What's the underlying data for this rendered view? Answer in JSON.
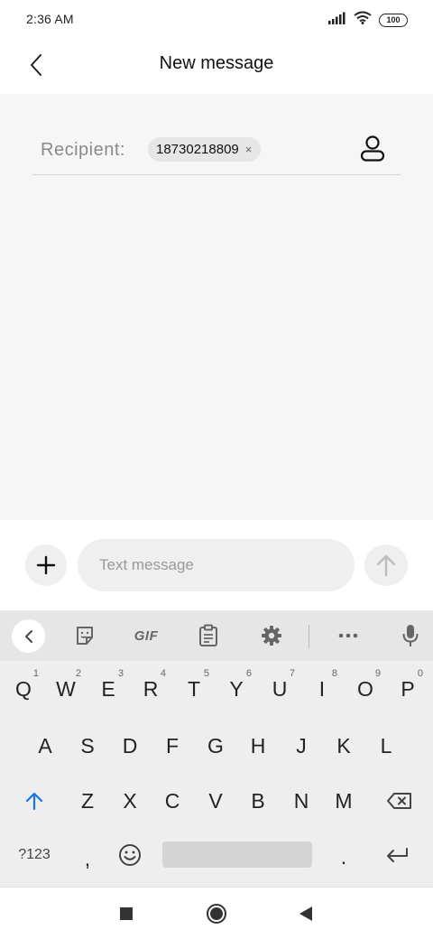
{
  "status_bar": {
    "time": "2:36 AM",
    "battery": "100"
  },
  "header": {
    "title": "New message"
  },
  "recipient": {
    "label": "Recipient:",
    "chip_number": "18730218809",
    "chip_remove": "×"
  },
  "compose": {
    "placeholder": "Text message"
  },
  "keyboard": {
    "toolbar": {
      "gif_label": "GIF"
    },
    "row1": [
      {
        "key": "Q",
        "hint": "1"
      },
      {
        "key": "W",
        "hint": "2"
      },
      {
        "key": "E",
        "hint": "3"
      },
      {
        "key": "R",
        "hint": "4"
      },
      {
        "key": "T",
        "hint": "5"
      },
      {
        "key": "Y",
        "hint": "6"
      },
      {
        "key": "U",
        "hint": "7"
      },
      {
        "key": "I",
        "hint": "8"
      },
      {
        "key": "O",
        "hint": "9"
      },
      {
        "key": "P",
        "hint": "0"
      }
    ],
    "row2": [
      "A",
      "S",
      "D",
      "F",
      "G",
      "H",
      "J",
      "K",
      "L"
    ],
    "row3": [
      "Z",
      "X",
      "C",
      "V",
      "B",
      "N",
      "M"
    ],
    "row4": {
      "symbols": "?123",
      "comma": ",",
      "period": "."
    }
  },
  "colors": {
    "shift_accent": "#1a73e8",
    "content_bg": "#f6f6f6"
  },
  "icons": {
    "back": "chevron-left-icon",
    "contact": "person-icon",
    "attach": "plus-icon",
    "send": "arrow-up-icon",
    "sticker": "sticker-icon",
    "clipboard": "clipboard-icon",
    "settings": "gear-icon",
    "more": "more-horizontal-icon",
    "mic": "microphone-icon",
    "shift": "shift-icon",
    "backspace": "backspace-icon",
    "emoji": "emoji-icon",
    "enter": "enter-icon",
    "nav_recents": "square-icon",
    "nav_home": "circle-icon",
    "nav_back": "triangle-back-icon"
  }
}
